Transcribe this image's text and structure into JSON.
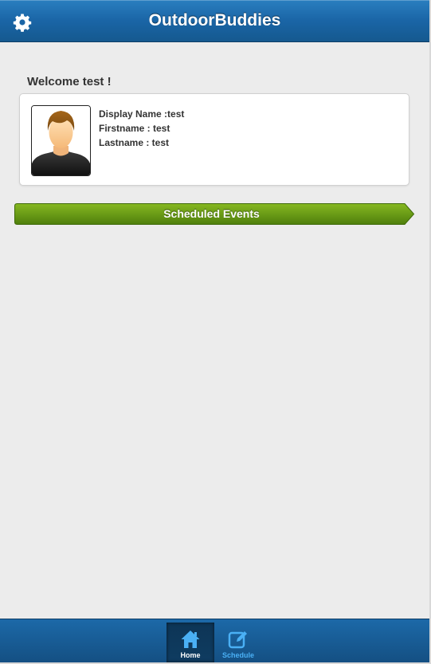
{
  "header": {
    "title": "OutdoorBuddies",
    "settings_icon": "gear-icon"
  },
  "welcome": {
    "text": "Welcome test !"
  },
  "profile": {
    "avatar_icon": "user-avatar",
    "display_name_line": "Display Name :test",
    "firstname_line": "Firstname : test",
    "lastname_line": "Lastname : test"
  },
  "events_button": {
    "label": "Scheduled Events",
    "color": "#6a9f18"
  },
  "footer": {
    "items": [
      {
        "label": "Home",
        "icon": "home-icon",
        "active": true
      },
      {
        "label": "Schedule",
        "icon": "edit-icon",
        "active": false
      }
    ]
  },
  "colors": {
    "header_bg": "#1a65a6",
    "content_bg": "#ececec",
    "nav_active_label": "#ffffff",
    "nav_inactive_label": "#4ab0f5"
  }
}
